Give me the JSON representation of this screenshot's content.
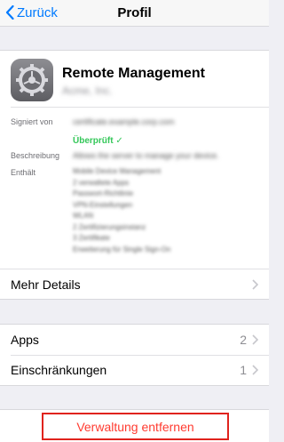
{
  "nav": {
    "back_label": "Zurück",
    "title": "Profil"
  },
  "profile": {
    "name": "Remote Management",
    "org": "Acme, Inc.",
    "signed_label": "Signiert von",
    "signed_value": "certificate.example.corp.com",
    "verified_label": "Überprüft",
    "desc_label": "Beschreibung",
    "desc_value": "Allows the server to manage your device.",
    "contains_label": "Enthält",
    "contains": [
      "Mobile Device Management",
      "2 verwaltete Apps",
      "Passwort-Richtlinie",
      "VPN-Einstellungen",
      "WLAN",
      "2 Zertifizierungsinstanz",
      "3 Zertifikate",
      "Erweiterung für Single Sign-On"
    ]
  },
  "rows": {
    "more_details": "Mehr Details",
    "apps": {
      "label": "Apps",
      "count": "2"
    },
    "restrictions": {
      "label": "Einschränkungen",
      "count": "1"
    }
  },
  "remove_label": "Verwaltung entfernen",
  "colors": {
    "accent": "#007aff",
    "verified": "#34c759",
    "destructive": "#ff3b30",
    "highlight_border": "#e0231d"
  }
}
